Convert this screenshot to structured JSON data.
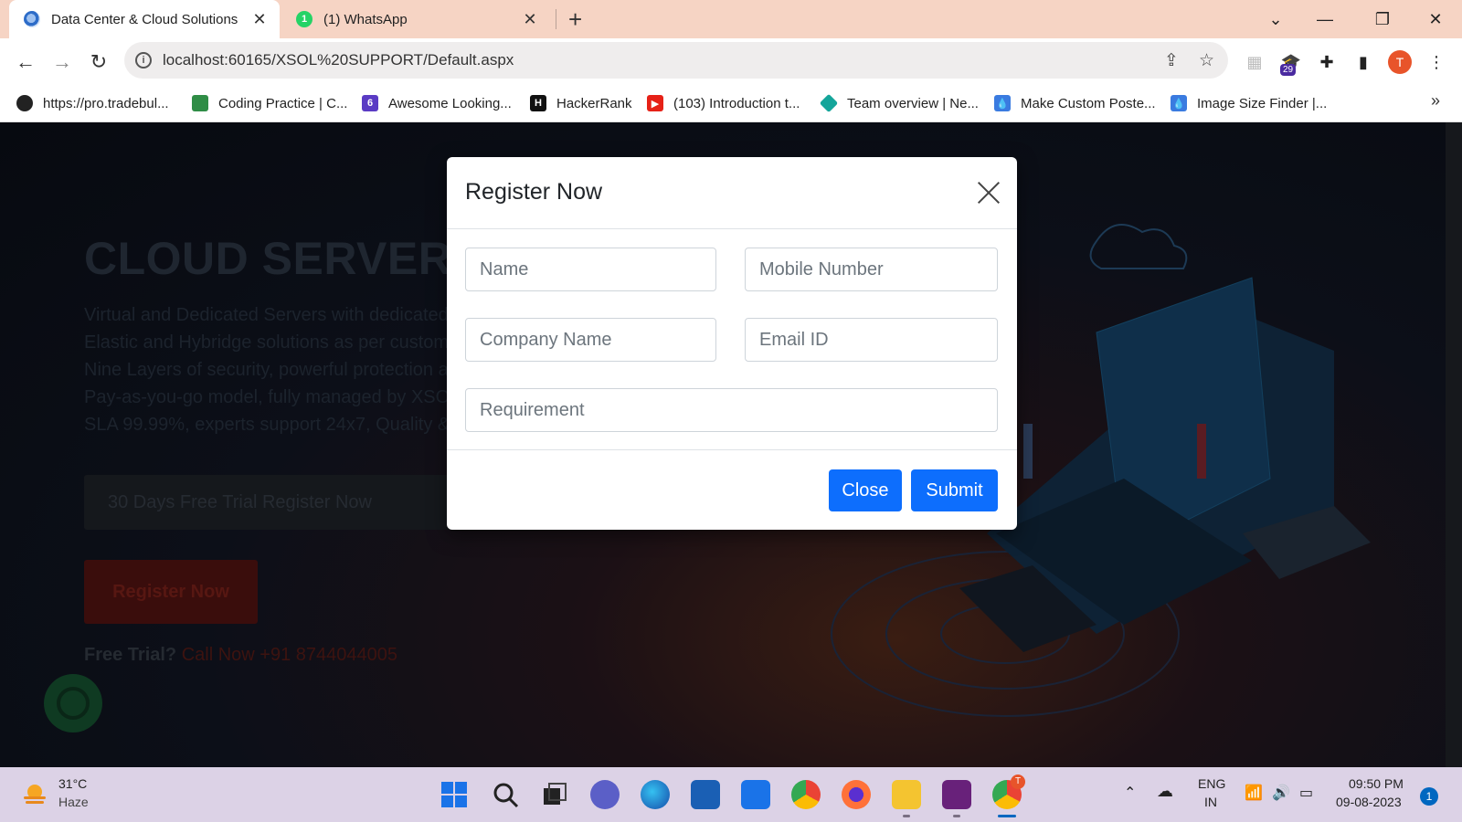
{
  "browser": {
    "tabs": [
      {
        "title": "Data Center & Cloud Solutions",
        "active": true,
        "icon": "globe-icon"
      },
      {
        "title": "(1) WhatsApp",
        "active": false,
        "icon": "whatsapp-icon",
        "badge": "1"
      }
    ],
    "url": "localhost:60165/XSOL%20SUPPORT/Default.aspx",
    "extension_badge": "29",
    "profile_initial": "T",
    "bookmarks": [
      {
        "label": "https://pro.tradebul...",
        "icon": "tradebulls-icon",
        "color": "#222222"
      },
      {
        "label": "Coding Practice | C...",
        "icon": "geeks-icon",
        "color": "#2f8d46"
      },
      {
        "label": "Awesome Looking...",
        "icon": "six-icon",
        "color": "#5a3bc4"
      },
      {
        "label": "HackerRank",
        "icon": "hackerrank-icon",
        "color": "#111111"
      },
      {
        "label": "(103) Introduction t...",
        "icon": "youtube-icon",
        "color": "#e62117"
      },
      {
        "label": "Team overview | Ne...",
        "icon": "netlify-icon",
        "color": "#14a59a"
      },
      {
        "label": "Make Custom Poste...",
        "icon": "drop-icon",
        "color": "#3a7be0"
      },
      {
        "label": "Image Size Finder |...",
        "icon": "drop-icon",
        "color": "#3a7be0"
      }
    ]
  },
  "hero": {
    "title": "CLOUD SERVER",
    "lines": [
      "Virtual and Dedicated Servers with dedicated",
      "Elastic and Hybridge solutions as per custom",
      "Nine Layers of security, powerful protection a",
      "Pay-as-you-go model, fully managed by XSO",
      "SLA 99.99%, experts support 24x7, Quality &"
    ],
    "trial_placeholder": "30 Days Free Trial Register Now",
    "register_label": "Register Now",
    "free_trial_label": "Free Trial?",
    "call_text": "Call Now +91 8744044005"
  },
  "modal": {
    "title": "Register Now",
    "fields": {
      "name": "Name",
      "mobile": "Mobile Number",
      "company": "Company Name",
      "email": "Email ID",
      "requirement": "Requirement"
    },
    "close_label": "Close",
    "submit_label": "Submit"
  },
  "taskbar": {
    "weather_temp": "31°C",
    "weather_desc": "Haze",
    "lang_top": "ENG",
    "lang_bottom": "IN",
    "time": "09:50 PM",
    "date": "09-08-2023",
    "notification_count": "1",
    "chrome_badge": "T"
  },
  "colors": {
    "primary_button": "#0d6efd",
    "tab_strip": "#f6d4c4",
    "taskbar": "#dcd2e6"
  }
}
